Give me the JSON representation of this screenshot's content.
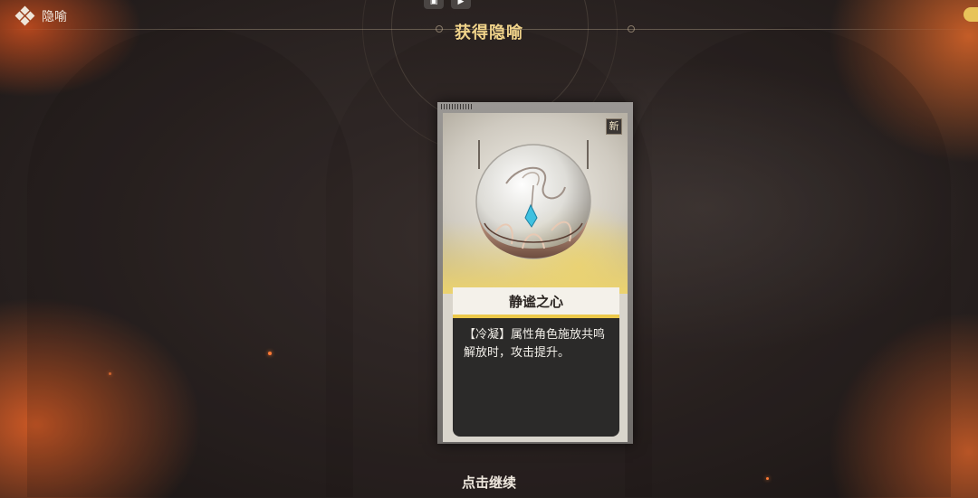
{
  "header": {
    "section_label": "隐喻",
    "section_icon": "diamond-cluster-icon",
    "title": "获得隐喻"
  },
  "status_bar": {
    "left_icon": "layout-icon",
    "right_icon": "video-icon"
  },
  "card": {
    "badge": "新",
    "name": "静谧之心",
    "description": "【冷凝】属性角色施放共鸣解放时，攻击提升。",
    "art_icon": "glass-orb-pendant-icon"
  },
  "footer": {
    "continue_label": "点击继续"
  },
  "colors": {
    "title_gold": "#f0d38a",
    "name_underline": "#ecc94a",
    "ember_orange": "#ff7a35"
  }
}
